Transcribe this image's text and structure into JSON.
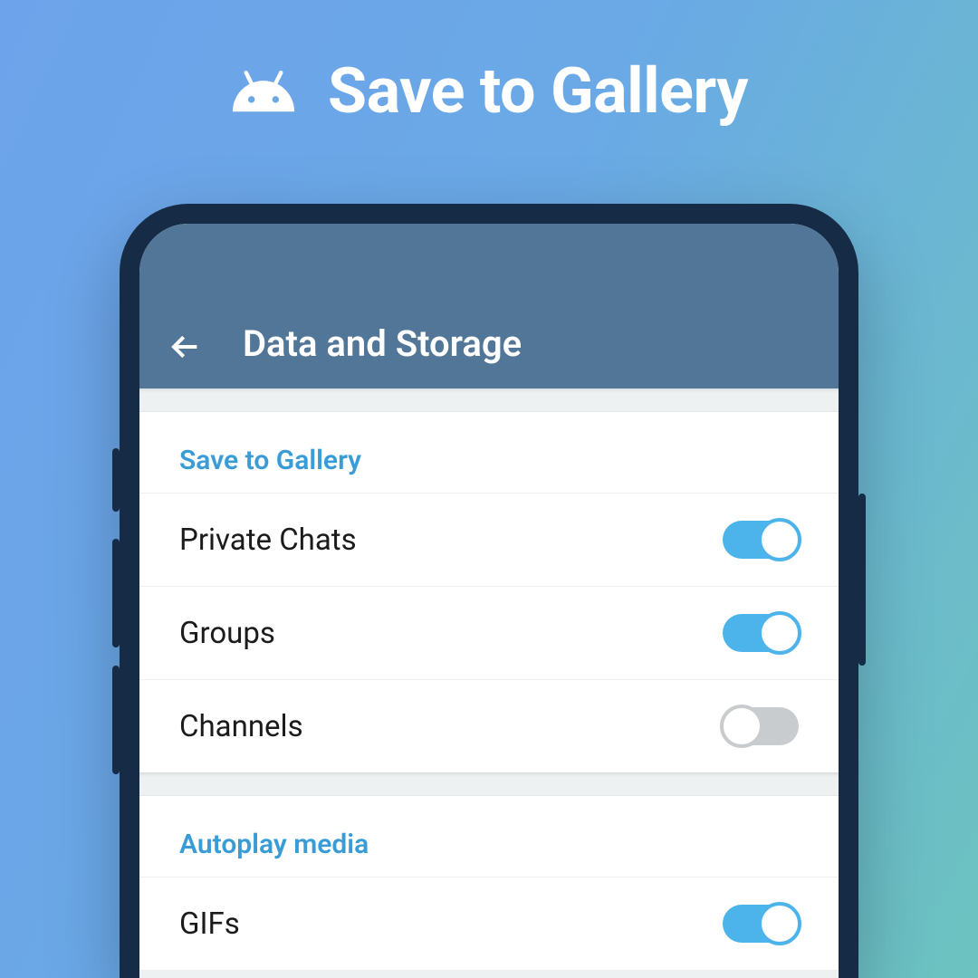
{
  "header": {
    "title": "Save to Gallery"
  },
  "appbar": {
    "title": "Data and Storage"
  },
  "sections": [
    {
      "title": "Save to Gallery",
      "rows": [
        {
          "label": "Private Chats",
          "on": true
        },
        {
          "label": "Groups",
          "on": true
        },
        {
          "label": "Channels",
          "on": false
        }
      ]
    },
    {
      "title": "Autoplay media",
      "rows": [
        {
          "label": "GIFs",
          "on": true
        }
      ]
    }
  ],
  "colors": {
    "accent": "#4cb4ea",
    "appbar": "#527697",
    "section_title": "#3a9cd6"
  }
}
